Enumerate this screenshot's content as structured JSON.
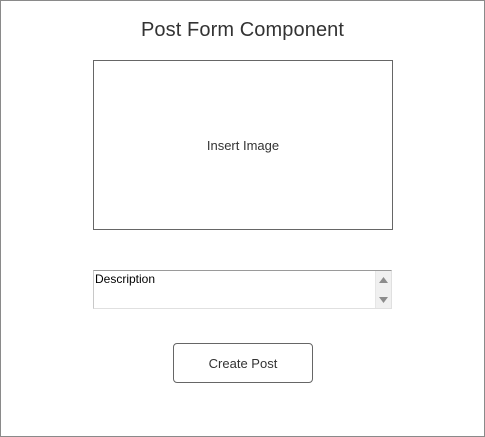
{
  "page": {
    "title": "Post Form Component"
  },
  "image_placeholder": {
    "label": "Insert Image"
  },
  "description": {
    "value": "Description",
    "scroll_up_icon": "triangle-up-icon",
    "scroll_down_icon": "triangle-down-icon"
  },
  "actions": {
    "create_label": "Create Post"
  },
  "colors": {
    "border_dark": "#666666",
    "frame_border": "#8a8a8a",
    "text": "#333333",
    "scrollbar_bg": "#f0f0f0",
    "arrow": "#8c8c8c"
  }
}
